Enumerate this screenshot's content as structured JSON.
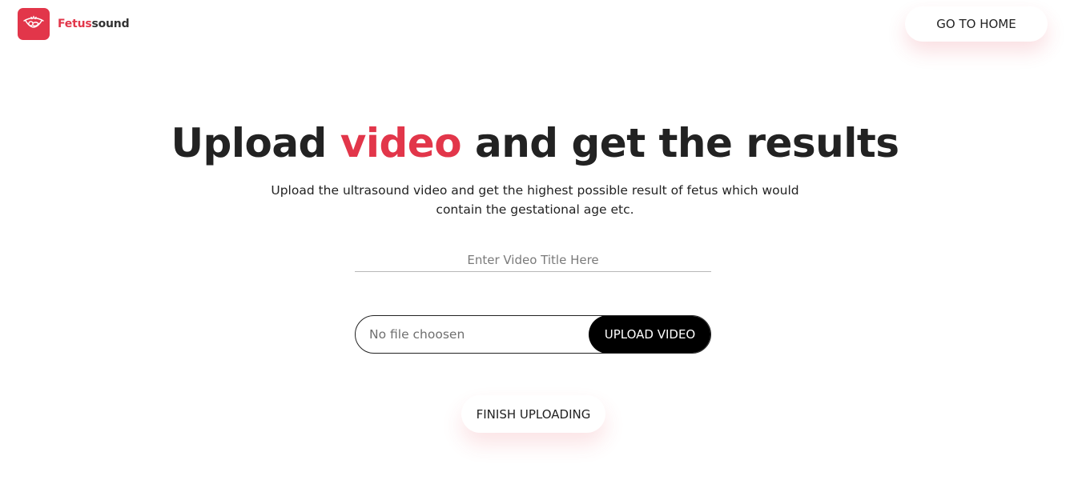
{
  "brand": {
    "name_part1": "Fetus",
    "name_part2": "sound",
    "logo_icon": "fetus-ultrasound-icon",
    "accent_color": "#e2364a"
  },
  "header": {
    "home_button_label": "GO TO HOME"
  },
  "hero": {
    "title_before": "Upload ",
    "title_accent": "video",
    "title_after": " and get the results",
    "subtitle": "Upload the ultrasound video and get the highest possible result of fetus which would contain the gestational age etc."
  },
  "form": {
    "title_placeholder": "Enter Video Title Here",
    "title_value": "",
    "file_status": "No file choosen",
    "upload_button_label": "UPLOAD VIDEO",
    "finish_button_label": "FINISH UPLOADING"
  }
}
